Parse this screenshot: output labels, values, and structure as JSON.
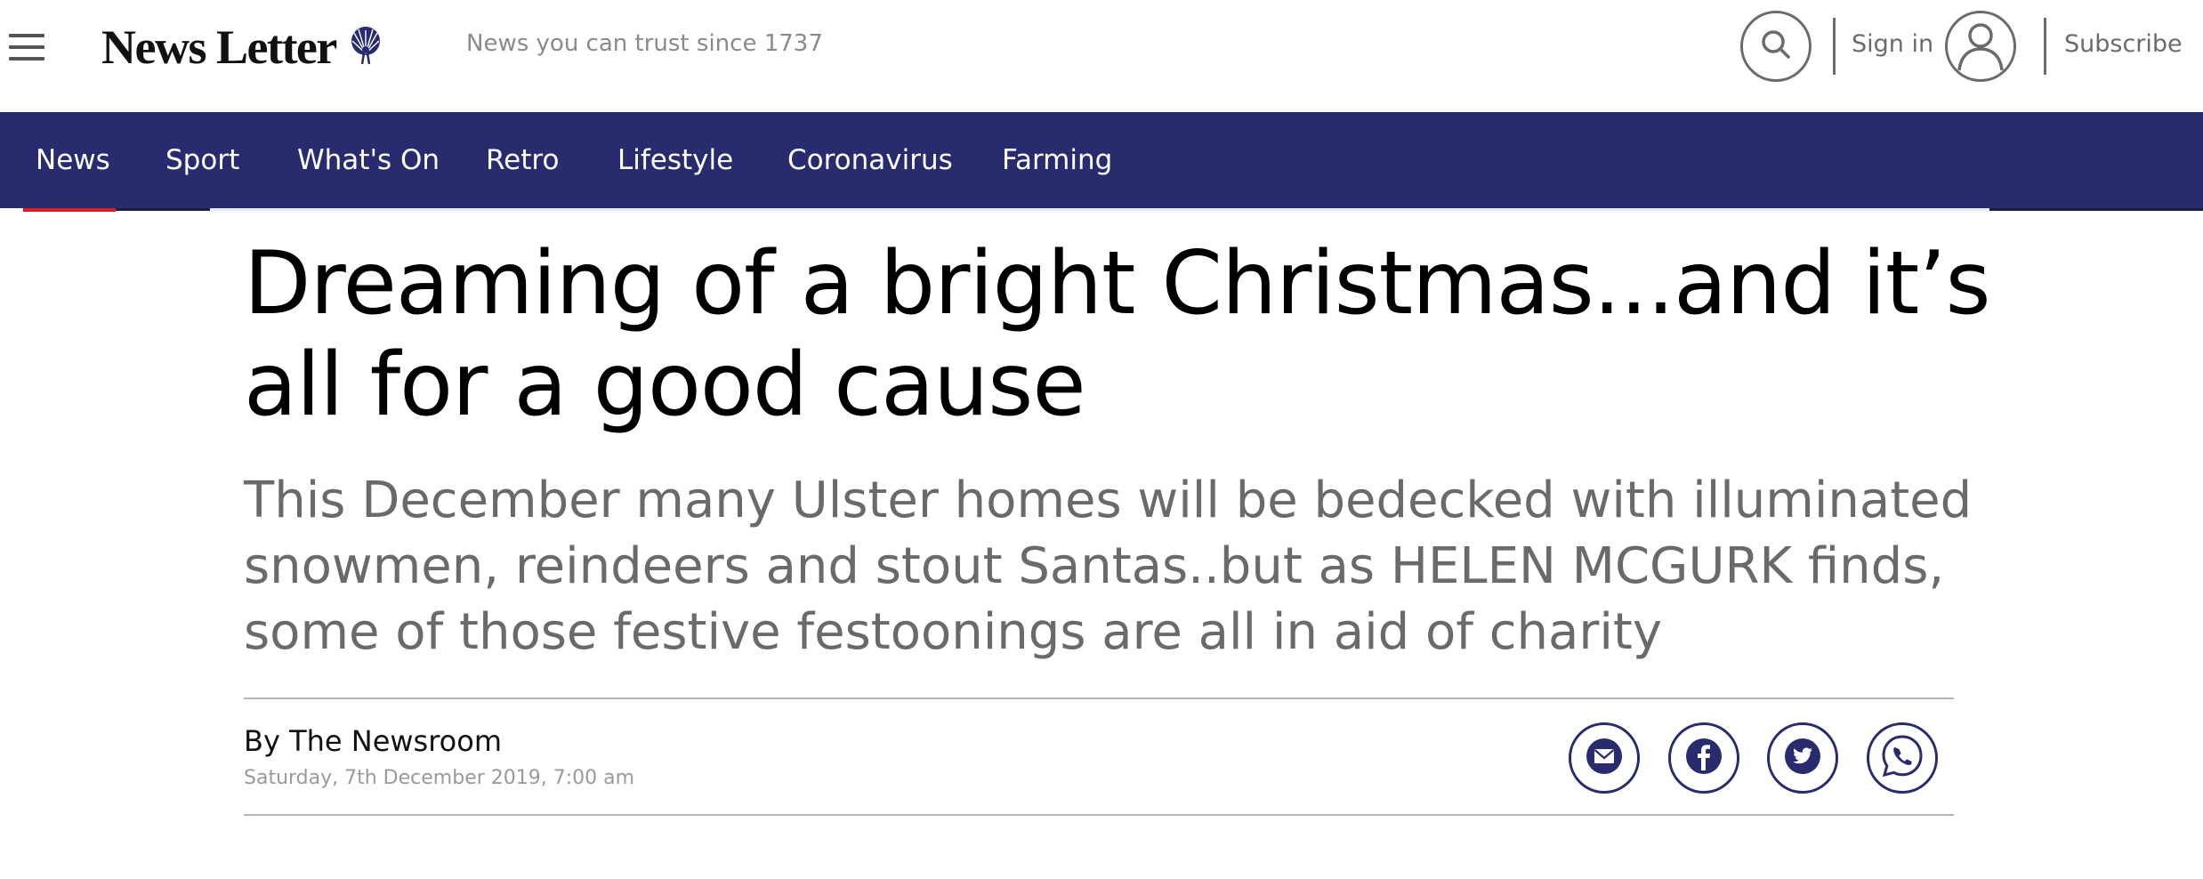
{
  "header": {
    "menu_icon": "hamburger-menu-icon",
    "logo_text": "News Letter",
    "logo_icon": "peacock-icon",
    "tagline": "News you can trust since 1737",
    "search_icon": "search-icon",
    "sign_in_label": "Sign in",
    "account_icon": "user-icon",
    "subscribe_label": "Subscribe"
  },
  "nav": {
    "items": [
      {
        "label": "News"
      },
      {
        "label": "Sport"
      },
      {
        "label": "What's On"
      },
      {
        "label": "Retro"
      },
      {
        "label": "Lifestyle"
      },
      {
        "label": "Coronavirus"
      },
      {
        "label": "Farming"
      }
    ],
    "active": "News"
  },
  "article": {
    "headline": "Dreaming of a bright Christmas...and it’s all for a good cause",
    "standfirst": "This December many Ulster homes will be bedecked with illuminated snowmen, reindeers and stout Santas..but as HELEN MCGURK finds, some of those festive festoonings are all in aid of charity",
    "byline": "By The Newsroom",
    "date": "Saturday, 7th December 2019, 7:00 am"
  },
  "share": {
    "icons": [
      "email-icon",
      "facebook-icon",
      "twitter-icon",
      "whatsapp-icon"
    ]
  },
  "colors": {
    "brand_navy": "#282c6f",
    "accent_red": "#d81d24",
    "muted_grey": "#6b6b6b",
    "standfirst_grey": "#6a6a6a"
  }
}
